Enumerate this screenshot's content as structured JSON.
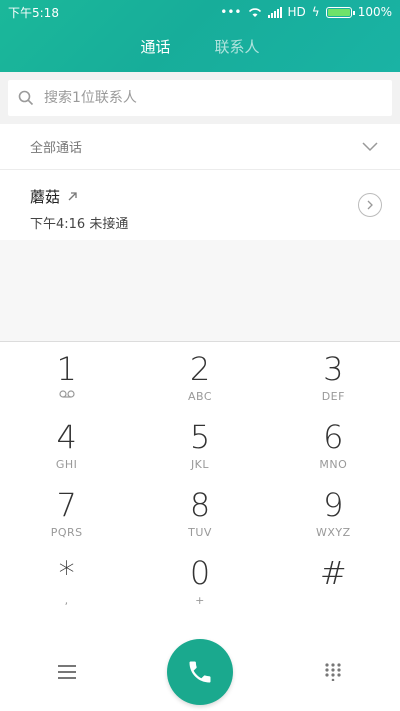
{
  "status": {
    "time": "下午5:18",
    "network": "HD",
    "battery": "100%",
    "battery_level": 1.0
  },
  "tabs": [
    "通话",
    "联系人"
  ],
  "search": {
    "placeholder": "搜索1位联系人"
  },
  "filter": {
    "label": "全部通话"
  },
  "calls": [
    {
      "name": "蘑菇",
      "time": "下午4:16",
      "status": "未接通"
    }
  ],
  "keys": [
    {
      "digit": "1",
      "letters": ""
    },
    {
      "digit": "2",
      "letters": "ABC"
    },
    {
      "digit": "3",
      "letters": "DEF"
    },
    {
      "digit": "4",
      "letters": "GHI"
    },
    {
      "digit": "5",
      "letters": "JKL"
    },
    {
      "digit": "6",
      "letters": "MNO"
    },
    {
      "digit": "7",
      "letters": "PQRS"
    },
    {
      "digit": "8",
      "letters": "TUV"
    },
    {
      "digit": "9",
      "letters": "WXYZ"
    },
    {
      "digit": "*",
      "letters": ","
    },
    {
      "digit": "0",
      "letters": "+"
    },
    {
      "digit": "#",
      "letters": ""
    }
  ],
  "colors": {
    "accent": "#1aa98e",
    "header": "#17ad9a"
  },
  "icons": {
    "menu": "menu-icon",
    "call": "phone-icon",
    "dialpad": "dialpad-icon",
    "voicemail": "voicemail-icon"
  }
}
